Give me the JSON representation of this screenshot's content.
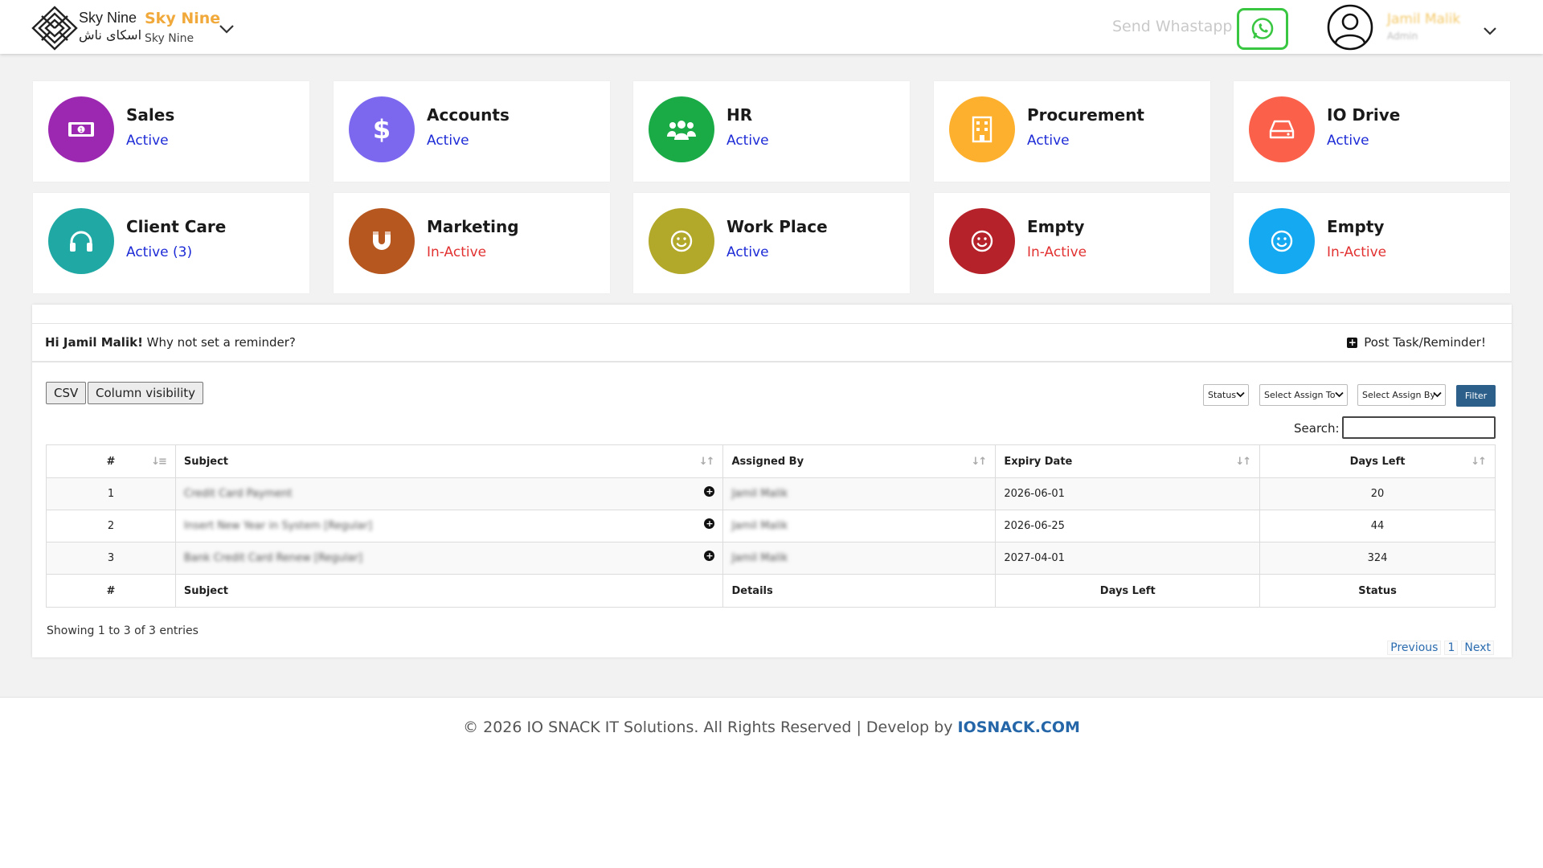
{
  "header": {
    "logo_en": "Sky Nine",
    "logo_ar": "اسکای ناش",
    "company_name": "Sky Nine",
    "company_sub": "Sky Nine",
    "send_whatsapp": "Send Whastapp",
    "user_name": "Jamil Malik",
    "user_role": "Admin"
  },
  "tiles": [
    {
      "name": "Sales",
      "status": "Active",
      "color": "#9c27b0",
      "icon": "money-icon"
    },
    {
      "name": "Accounts",
      "status": "Active",
      "color": "#7b68ee",
      "icon": "dollar-icon"
    },
    {
      "name": "HR",
      "status": "Active",
      "color": "#1aab47",
      "icon": "users-icon"
    },
    {
      "name": "Procurement",
      "status": "Active",
      "color": "#fdb02d",
      "icon": "building-icon"
    },
    {
      "name": "IO Drive",
      "status": "Active",
      "color": "#fa604a",
      "icon": "hard-drive-icon"
    },
    {
      "name": "Client Care",
      "status": "Active",
      "count": "(3)",
      "color": "#20a9a4",
      "icon": "headset-icon"
    },
    {
      "name": "Marketing",
      "status": "In-Active",
      "color": "#b5571f",
      "icon": "magnet-icon"
    },
    {
      "name": "Work Place",
      "status": "Active",
      "color": "#b2a82a",
      "icon": "smiley-icon"
    },
    {
      "name": "Empty",
      "status": "In-Active",
      "color": "#b5222a",
      "icon": "smiley-icon"
    },
    {
      "name": "Empty",
      "status": "In-Active",
      "color": "#14a9f0",
      "icon": "smiley-icon"
    }
  ],
  "reminder": {
    "greeting_name": "Hi Jamil Malik!",
    "greeting_text": " Why not set a reminder?",
    "post_task": "Post Task/Reminder!"
  },
  "toolbar": {
    "csv": "CSV",
    "column_visibility": "Column visibility",
    "status_select": "Status",
    "assign_to_select": "Select Assign To",
    "assign_by_select": "Select Assign By",
    "filter": "Filter",
    "search_label": "Search:"
  },
  "table": {
    "headers": [
      "#",
      "Subject",
      "Assigned By",
      "Expiry Date",
      "Days Left"
    ],
    "rows": [
      {
        "num": "1",
        "subject": "Credit Card Payment",
        "assigned_by": "Jamil Malik",
        "expiry": "2026-06-01",
        "days_left": "20"
      },
      {
        "num": "2",
        "subject": "Insert New Year in System [Regular]",
        "assigned_by": "Jamil Malik",
        "expiry": "2026-06-25",
        "days_left": "44"
      },
      {
        "num": "3",
        "subject": "Bank Credit Card Renew [Regular]",
        "assigned_by": "Jamil Malik",
        "expiry": "2027-04-01",
        "days_left": "324"
      }
    ],
    "footers": [
      "#",
      "Subject",
      "Details",
      "Days Left",
      "Status"
    ],
    "showing": "Showing 1 to 3 of 3 entries",
    "pager": {
      "previous": "Previous",
      "page": "1",
      "next": "Next"
    }
  },
  "footer": {
    "text": "© 2026 IO SNACK IT Solutions. All Rights Reserved | Develop by ",
    "brand": "IOSNACK.COM"
  },
  "colors": {
    "active": "#1d2bd6",
    "inactive": "#e23232",
    "whatsapp": "#39c641",
    "filter_button": "#2c5f8a",
    "company_name": "#f0a93a",
    "footer_brand": "#2466a8"
  }
}
